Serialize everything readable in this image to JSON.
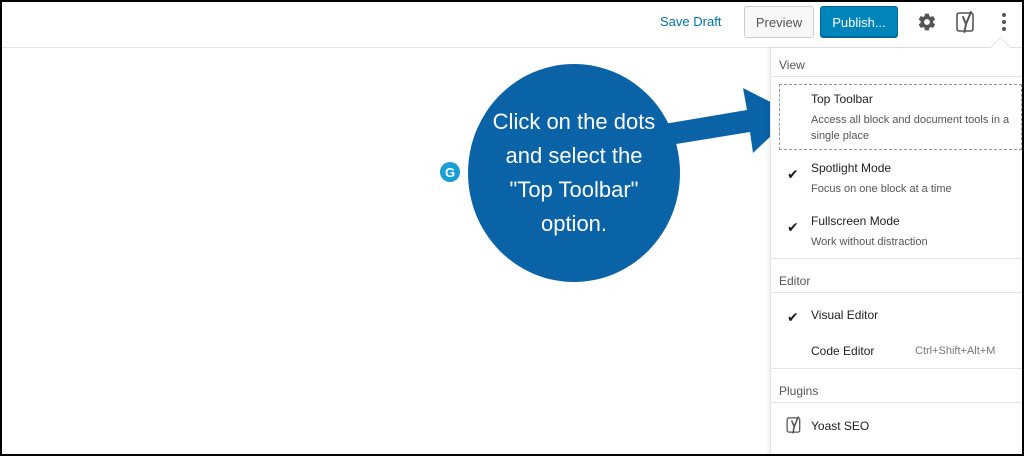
{
  "topbar": {
    "save_draft_label": "Save Draft",
    "preview_label": "Preview",
    "publish_label": "Publish..."
  },
  "menu": {
    "view_section_title": "View",
    "items": [
      {
        "title": "Top Toolbar",
        "subtitle": "Access all block and document tools in a single place",
        "checked": false
      },
      {
        "title": "Spotlight Mode",
        "subtitle": "Focus on one block at a time",
        "checked": true
      },
      {
        "title": "Fullscreen Mode",
        "subtitle": "Work without distraction",
        "checked": true
      }
    ],
    "editor_section_title": "Editor",
    "editor_items": [
      {
        "title": "Visual Editor",
        "checked": true
      },
      {
        "title": "Code Editor",
        "shortcut": "Ctrl+Shift+Alt+M",
        "checked": false
      }
    ],
    "plugins_section_title": "Plugins",
    "plugins_items": [
      {
        "title": "Yoast SEO"
      }
    ]
  },
  "callout": {
    "text": "Click on the dots and select the \"Top Toolbar\" option."
  },
  "icons": {
    "gear": "gear-icon",
    "yoast": "yoast-icon",
    "more": "more-vertical-icon",
    "check": "check-icon",
    "grammarly": "grammarly-icon"
  },
  "colors": {
    "primary": "#0085ba",
    "callout": "#0a62a7",
    "link": "#0073aa"
  }
}
